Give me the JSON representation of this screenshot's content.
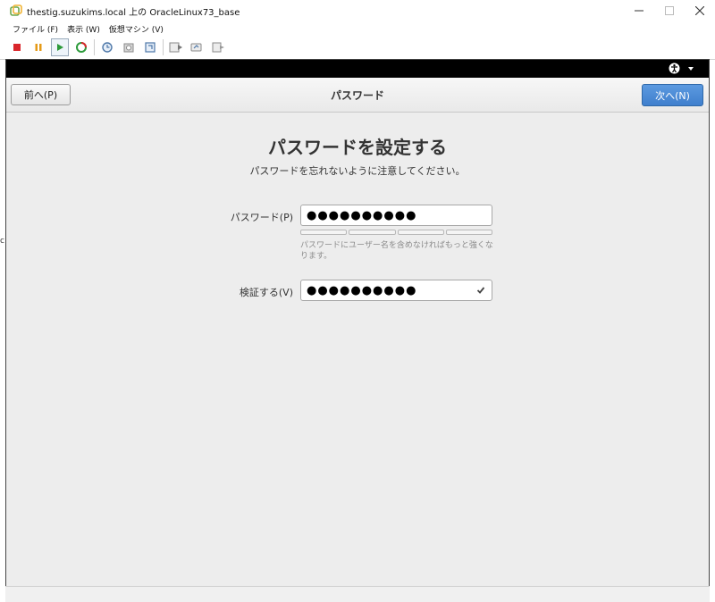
{
  "window": {
    "title": "thestig.suzukims.local 上の OracleLinux73_base",
    "minimize_glyph": "—",
    "close_glyph": "✕"
  },
  "menu": [
    {
      "label": "ファイル (F)"
    },
    {
      "label": "表示 (W)"
    },
    {
      "label": "仮想マシン (V)"
    }
  ],
  "toolbar": {
    "icons": [
      "stop-icon",
      "pause-icon",
      "play-icon",
      "restart-icon",
      "snapshot-icon",
      "snapshot-manage-icon",
      "revert-icon",
      "send-keys-icon",
      "settings-icon",
      "send-icon"
    ],
    "colors": {
      "stop": "#d9262b",
      "pause": "#e59a17",
      "play": "#2c9a3a"
    }
  },
  "stray_glyph": "c",
  "installer": {
    "back_label": "前へ(P)",
    "title": "パスワード",
    "next_label": "次へ(N)",
    "heading": "パスワードを設定する",
    "subheading": "パスワードを忘れないように注意してください。",
    "password_label": "パスワード(P)",
    "password_value": "●●●●●●●●●●",
    "hint": "パスワードにユーザー名を含めなければもっと強くなります。",
    "verify_label": "検証する(V)",
    "verify_value": "●●●●●●●●●●",
    "accent_color": "#4a8bd8"
  }
}
